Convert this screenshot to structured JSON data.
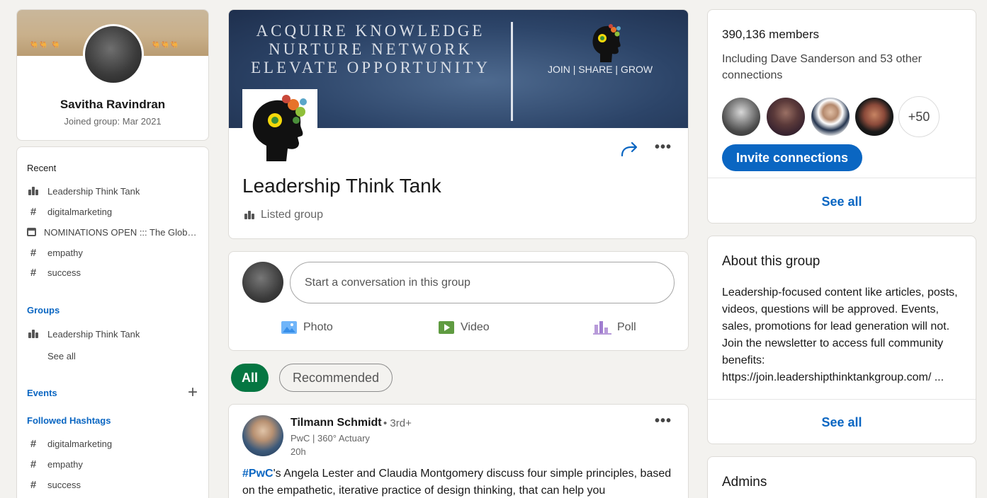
{
  "profile": {
    "name": "Savitha Ravindran",
    "joined": "Joined group: Mar 2021"
  },
  "nav": {
    "recent_heading": "Recent",
    "recent": [
      {
        "icon": "group-icon",
        "label": "Leadership Think Tank"
      },
      {
        "icon": "hashtag-icon",
        "label": "digitalmarketing"
      },
      {
        "icon": "calendar-icon",
        "label": "NOMINATIONS OPEN ::: The Global Leadership Awards"
      },
      {
        "icon": "hashtag-icon",
        "label": "empathy"
      },
      {
        "icon": "hashtag-icon",
        "label": "success"
      }
    ],
    "groups_heading": "Groups",
    "groups": [
      {
        "icon": "group-icon",
        "label": "Leadership Think Tank"
      }
    ],
    "groups_see_all": "See all",
    "events_heading": "Events",
    "hashtags_heading": "Followed Hashtags",
    "hashtags": [
      {
        "icon": "hashtag-icon",
        "label": "digitalmarketing"
      },
      {
        "icon": "hashtag-icon",
        "label": "empathy"
      },
      {
        "icon": "hashtag-icon",
        "label": "success"
      }
    ]
  },
  "group": {
    "banner_lines": [
      "ACQUIRE KNOWLEDGE",
      "NURTURE NETWORK",
      "ELEVATE OPPORTUNITY"
    ],
    "banner_slogan": "JOIN | SHARE | GROW",
    "title": "Leadership Think Tank",
    "type": "Listed group"
  },
  "composer": {
    "placeholder": "Start a conversation in this group",
    "actions": [
      {
        "icon": "photo-icon",
        "label": "Photo"
      },
      {
        "icon": "video-icon",
        "label": "Video"
      },
      {
        "icon": "poll-icon",
        "label": "Poll"
      }
    ]
  },
  "filters": {
    "all": "All",
    "recommended": "Recommended"
  },
  "post": {
    "author": "Tilmann Schmidt",
    "degree": "• 3rd+",
    "headline": "PwC | 360° Actuary",
    "time": "20h",
    "hashtag": "#PwC",
    "body_after_hashtag": "'s Angela Lester and Claudia Montgomery discuss four simple principles, based on the empathetic, iterative practice of design thinking, that can help you"
  },
  "members": {
    "count": "390,136 members",
    "subtitle": "Including Dave Sanderson and 53 other connections",
    "more_badge": "+50",
    "invite_label": "Invite connections",
    "see_all": "See all"
  },
  "about": {
    "title": "About this group",
    "body": "Leadership-focused content like articles, posts, videos, questions will be approved. Events, sales, promotions for lead generation will not. Join the newsletter to access full community benefits: https://join.leadershipthinktankgroup.com/ ...",
    "see_all": "See all"
  },
  "admins": {
    "title": "Admins"
  },
  "colors": {
    "brand_blue": "#0a66c2",
    "filter_active": "#057642",
    "page_bg": "#f3f2ef"
  }
}
